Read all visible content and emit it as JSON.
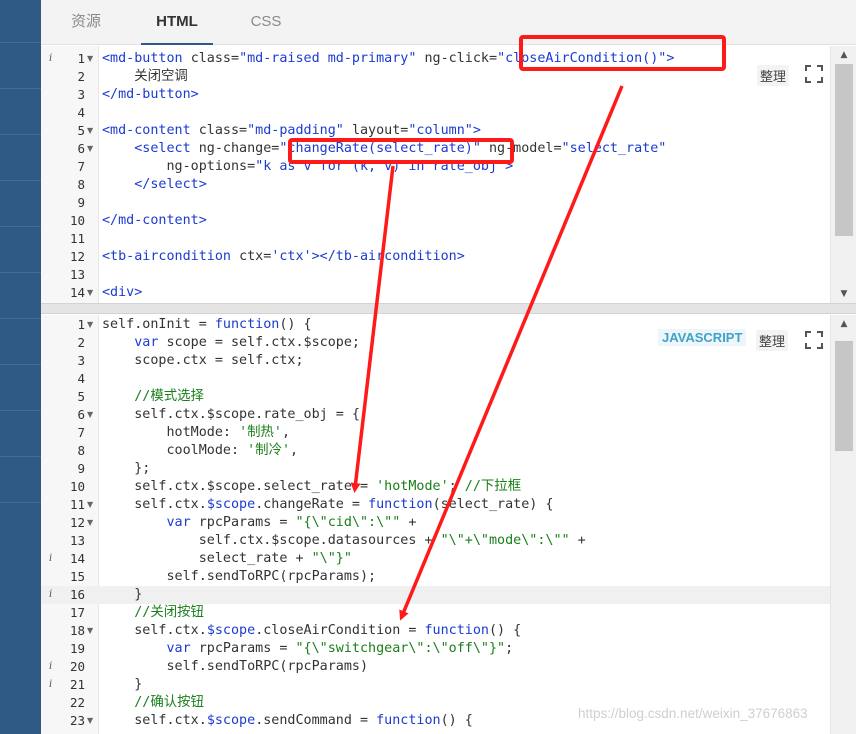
{
  "tabs": [
    {
      "label": "资源",
      "active": false
    },
    {
      "label": "HTML",
      "active": true
    },
    {
      "label": "CSS",
      "active": false
    }
  ],
  "html_editor": {
    "format_label": "整理",
    "fullscreen_icon": "fullscreen-icon",
    "lines": [
      {
        "n": "1",
        "info": true,
        "fold": true,
        "html": "<span class='tag'>&lt;md-button</span> <span class='attr'>class=</span><span class='tag'>\"md-raised md-primary\"</span> <span class='attr'>ng-click=</span><span class='tag'>\"closeAirCondition()\"</span><span class='tag'>&gt;</span>"
      },
      {
        "n": "2",
        "html": "    关闭空调"
      },
      {
        "n": "3",
        "html": "<span class='tag'>&lt;/md-button&gt;</span>"
      },
      {
        "n": "4",
        "html": ""
      },
      {
        "n": "5",
        "fold": true,
        "html": "<span class='tag'>&lt;md-content</span> <span class='attr'>class=</span><span class='tag'>\"md-padding\"</span> <span class='attr'>layout=</span><span class='tag'>\"column\"</span><span class='tag'>&gt;</span>"
      },
      {
        "n": "6",
        "fold": true,
        "html": "    <span class='tag'>&lt;select</span> <span class='attr'>ng-change=</span><span class='tag'>\"changeRate(select_rate)\"</span> <span class='attr'>ng-model=</span><span class='tag'>\"select_rate\"</span>"
      },
      {
        "n": "7",
        "html": "        <span class='attr'>ng-options=</span><span class='tag'>\"k as v for (k, v) in rate_obj\"</span><span class='tag'>&gt;</span>"
      },
      {
        "n": "8",
        "html": "    <span class='tag'>&lt;/select&gt;</span>"
      },
      {
        "n": "9",
        "html": ""
      },
      {
        "n": "10",
        "html": "<span class='tag'>&lt;/md-content&gt;</span>"
      },
      {
        "n": "11",
        "html": ""
      },
      {
        "n": "12",
        "html": "<span class='tag'>&lt;tb-aircondition</span> <span class='attr'>ctx=</span><span class='tag'>'ctx'</span><span class='tag'>&gt;&lt;/tb-aircondition&gt;</span>"
      },
      {
        "n": "13",
        "html": ""
      },
      {
        "n": "14",
        "fold": true,
        "html": "<span class='tag'>&lt;div&gt;</span>"
      }
    ]
  },
  "js_editor": {
    "lang_label": "JAVASCRIPT",
    "format_label": "整理",
    "fullscreen_icon": "fullscreen-icon",
    "lines": [
      {
        "n": "1",
        "fold": true,
        "html": "self.onInit = <span class='kw'>function</span>() {"
      },
      {
        "n": "2",
        "html": "    <span class='kw'>var</span> scope = self.ctx.$scope;"
      },
      {
        "n": "3",
        "html": "    scope.ctx = self.ctx;"
      },
      {
        "n": "4",
        "html": ""
      },
      {
        "n": "5",
        "html": "    <span class='com'>//模式选择</span>"
      },
      {
        "n": "6",
        "fold": true,
        "html": "    self.ctx.$scope.rate_obj = {"
      },
      {
        "n": "7",
        "html": "        hotMode: <span class='str'>'制热'</span>,"
      },
      {
        "n": "8",
        "html": "        coolMode: <span class='str'>'制冷'</span>,"
      },
      {
        "n": "9",
        "html": "    };"
      },
      {
        "n": "10",
        "html": "    self.ctx.$scope.select_rate = <span class='str'>'hotMode'</span>; <span class='com'>//下拉框</span>"
      },
      {
        "n": "11",
        "fold": true,
        "html": "    self.ctx.<span class='kw'>$scope</span>.changeRate = <span class='kw'>function</span>(select_rate) {"
      },
      {
        "n": "12",
        "fold": true,
        "html": "        <span class='kw'>var</span> rpcParams = <span class='str'>\"{\\\"cid\\\":\\\"\"</span> +"
      },
      {
        "n": "13",
        "html": "            self.ctx.$scope.datasources + <span class='str'>\"\\\"+\\\"mode\\\":\\\"\"</span> +"
      },
      {
        "n": "14",
        "info": true,
        "html": "            select_rate + <span class='str'>\"\\\"}\"</span>"
      },
      {
        "n": "15",
        "html": "        self.sendToRPC(rpcParams);"
      },
      {
        "n": "16",
        "info": true,
        "hl": true,
        "html": "    }"
      },
      {
        "n": "17",
        "html": "    <span class='com'>//关闭按钮</span>"
      },
      {
        "n": "18",
        "fold": true,
        "html": "    self.ctx.<span class='kw'>$scope</span>.closeAirCondition = <span class='kw'>function</span>() {"
      },
      {
        "n": "19",
        "html": "        <span class='kw'>var</span> rpcParams = <span class='str'>\"{\\\"switchgear\\\":\\\"off\\\"}\"</span>;"
      },
      {
        "n": "20",
        "info": true,
        "html": "        self.sendToRPC(rpcParams)"
      },
      {
        "n": "21",
        "info": true,
        "html": "    }"
      },
      {
        "n": "22",
        "html": "    <span class='com'>//确认按钮</span>"
      },
      {
        "n": "23",
        "fold": true,
        "html": "    self.ctx.<span class='kw'>$scope</span>.sendCommand = <span class='kw'>function</span>() {"
      }
    ]
  },
  "colors": {
    "accent": "#2f5a86",
    "annotation": "#ff1a1a"
  },
  "watermark": "https://blog.csdn.net/weixin_37676863"
}
